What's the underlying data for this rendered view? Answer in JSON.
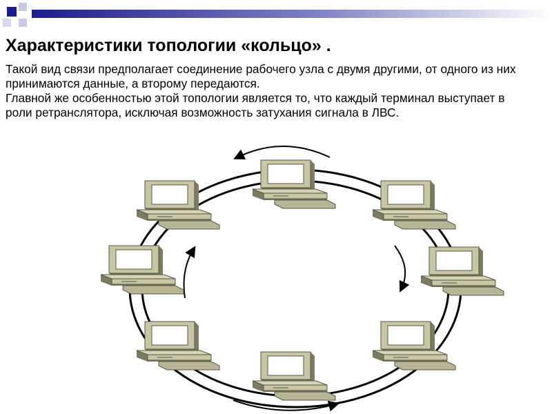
{
  "slide": {
    "title": "Характеристики топологии «кольцо» .",
    "paragraphs": [
      "Такой вид связи предполагает соединение рабочего узла с двумя другими, от одного из них принимаются данные, а второму передаются.",
      "Главной же особенностью этой топологии является то, что каждый терминал выступает в роли ретранслятора, исключая возможность затухания сигнала в ЛВС."
    ]
  },
  "theme": {
    "accent_dark": "#1c1c8c",
    "accent_light": "#c9cbe6",
    "computer_body": "#c9c6a6",
    "computer_shadow": "#7c7a62",
    "ring": "#000000"
  },
  "diagram": {
    "topology": "ring",
    "nodes": [
      "computer",
      "computer",
      "computer",
      "computer",
      "computer",
      "computer",
      "computer",
      "computer"
    ],
    "data_flow": "clockwise"
  }
}
